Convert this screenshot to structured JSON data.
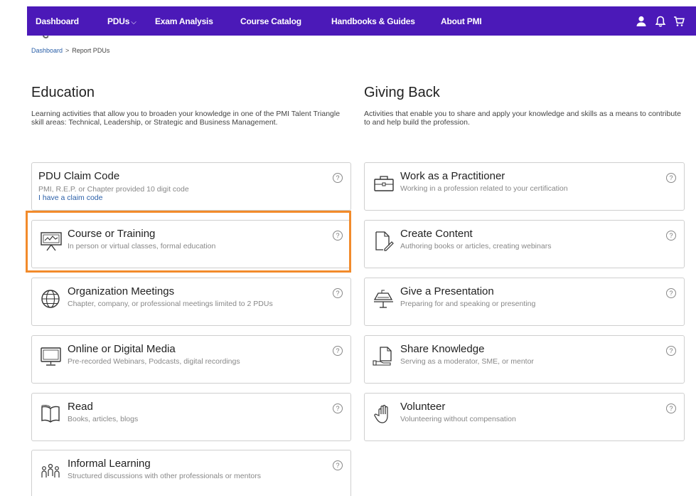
{
  "nav": {
    "items": [
      {
        "label": "Dashboard"
      },
      {
        "label": "PDUs",
        "chevron": "⌵"
      },
      {
        "label": "Exam Analysis"
      },
      {
        "label": "Course Catalog"
      },
      {
        "label": "Handbooks & Guides"
      },
      {
        "label": "About PMI"
      }
    ],
    "icons": [
      "user-icon",
      "bell-icon",
      "cart-icon"
    ],
    "accent": "#4b19b8"
  },
  "breadcrumb": {
    "home": "Dashboard",
    "separator": ">",
    "current": "Report PDUs"
  },
  "education": {
    "title": "Education",
    "description": "Learning activities that allow you to broaden your knowledge in one of the PMI Talent Triangle skill areas: Technical, Leadership, or Strategic and Business Management.",
    "claim_card": {
      "title": "PDU Claim Code",
      "subtitle": "PMI, R.E.P. or Chapter provided 10 digit code",
      "link": "I have a claim code",
      "help": "?"
    },
    "cards": [
      {
        "title": "Course or Training",
        "subtitle": "In person or virtual classes, formal education",
        "icon": "presentation-board-icon",
        "help": "?"
      },
      {
        "title": "Organization Meetings",
        "subtitle": "Chapter, company, or professional meetings limited to 2 PDUs",
        "icon": "globe-icon",
        "help": "?"
      },
      {
        "title": "Online or Digital Media",
        "subtitle": "Pre-recorded Webinars, Podcasts, digital recordings",
        "icon": "monitor-icon",
        "help": "?"
      },
      {
        "title": "Read",
        "subtitle": "Books, articles, blogs",
        "icon": "book-icon",
        "help": "?"
      },
      {
        "title": "Informal Learning",
        "subtitle": "Structured discussions with other professionals or mentors",
        "icon": "people-icon",
        "help": "?"
      }
    ]
  },
  "giving_back": {
    "title": "Giving Back",
    "description": "Activities that enable you to share and apply your knowledge and skills as a means to contribute to and help build the profession.",
    "cards": [
      {
        "title": "Work as a Practitioner",
        "subtitle": "Working in a profession related to your certification",
        "icon": "briefcase-icon",
        "help": "?"
      },
      {
        "title": "Create Content",
        "subtitle": "Authoring books or articles, creating webinars",
        "icon": "document-pen-icon",
        "help": "?"
      },
      {
        "title": "Give a Presentation",
        "subtitle": "Preparing for and speaking or presenting",
        "icon": "podium-icon",
        "help": "?"
      },
      {
        "title": "Share Knowledge",
        "subtitle": "Serving as a moderator, SME, or mentor",
        "icon": "hand-document-icon",
        "help": "?"
      },
      {
        "title": "Volunteer",
        "subtitle": "Volunteering without compensation",
        "icon": "raised-hand-icon",
        "help": "?"
      }
    ]
  },
  "highlight_color": "#f28b2b"
}
